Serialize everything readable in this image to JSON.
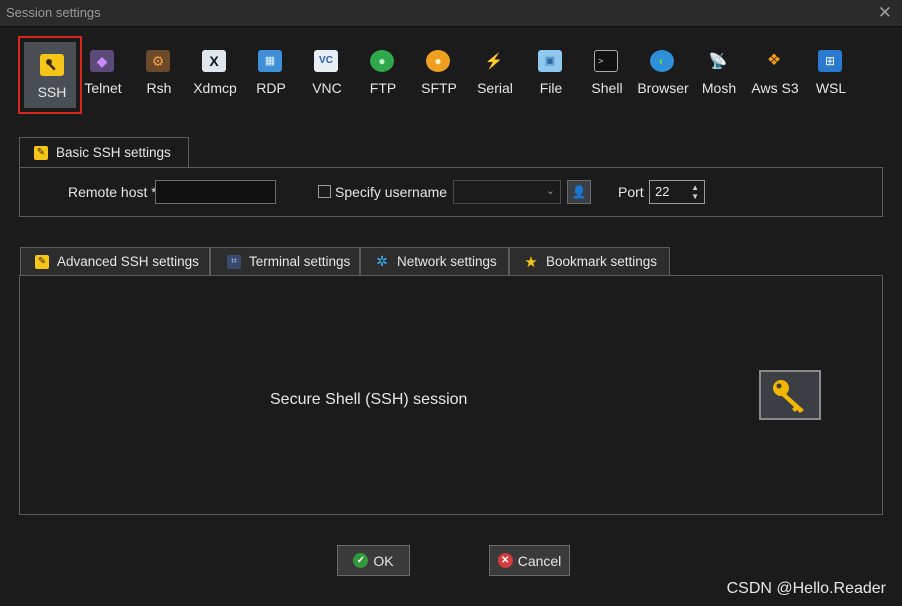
{
  "window": {
    "title": "Session settings",
    "close_glyph": "✕"
  },
  "protocols": [
    {
      "label": "SSH",
      "icon": "ssh-key-icon"
    },
    {
      "label": "Telnet",
      "icon": "telnet-icon"
    },
    {
      "label": "Rsh",
      "icon": "rsh-icon"
    },
    {
      "label": "Xdmcp",
      "icon": "xdmcp-icon"
    },
    {
      "label": "RDP",
      "icon": "rdp-icon"
    },
    {
      "label": "VNC",
      "icon": "vnc-icon"
    },
    {
      "label": "FTP",
      "icon": "ftp-icon"
    },
    {
      "label": "SFTP",
      "icon": "sftp-icon"
    },
    {
      "label": "Serial",
      "icon": "serial-icon"
    },
    {
      "label": "File",
      "icon": "file-icon"
    },
    {
      "label": "Shell",
      "icon": "shell-icon"
    },
    {
      "label": "Browser",
      "icon": "browser-icon"
    },
    {
      "label": "Mosh",
      "icon": "mosh-icon"
    },
    {
      "label": "Aws S3",
      "icon": "aws-s3-icon"
    },
    {
      "label": "WSL",
      "icon": "wsl-icon"
    }
  ],
  "basic": {
    "tab_label": "Basic SSH settings",
    "remote_host_label": "Remote host *",
    "remote_host_value": "",
    "specify_username_label": "Specify username",
    "username_value": "",
    "port_label": "Port",
    "port_value": "22"
  },
  "tabs": [
    {
      "label": "Advanced SSH settings",
      "icon": "wrench-icon"
    },
    {
      "label": "Terminal settings",
      "icon": "terminal-icon"
    },
    {
      "label": "Network settings",
      "icon": "network-icon"
    },
    {
      "label": "Bookmark settings",
      "icon": "star-icon"
    }
  ],
  "panel": {
    "description": "Secure Shell (SSH) session"
  },
  "buttons": {
    "ok": "OK",
    "cancel": "Cancel"
  },
  "watermark": "CSDN @Hello.Reader",
  "colors": {
    "selection_border": "#d7261e",
    "key_yellow": "#f2b705",
    "ok_green": "#2f9a3a",
    "cancel_red": "#d63b3b"
  }
}
